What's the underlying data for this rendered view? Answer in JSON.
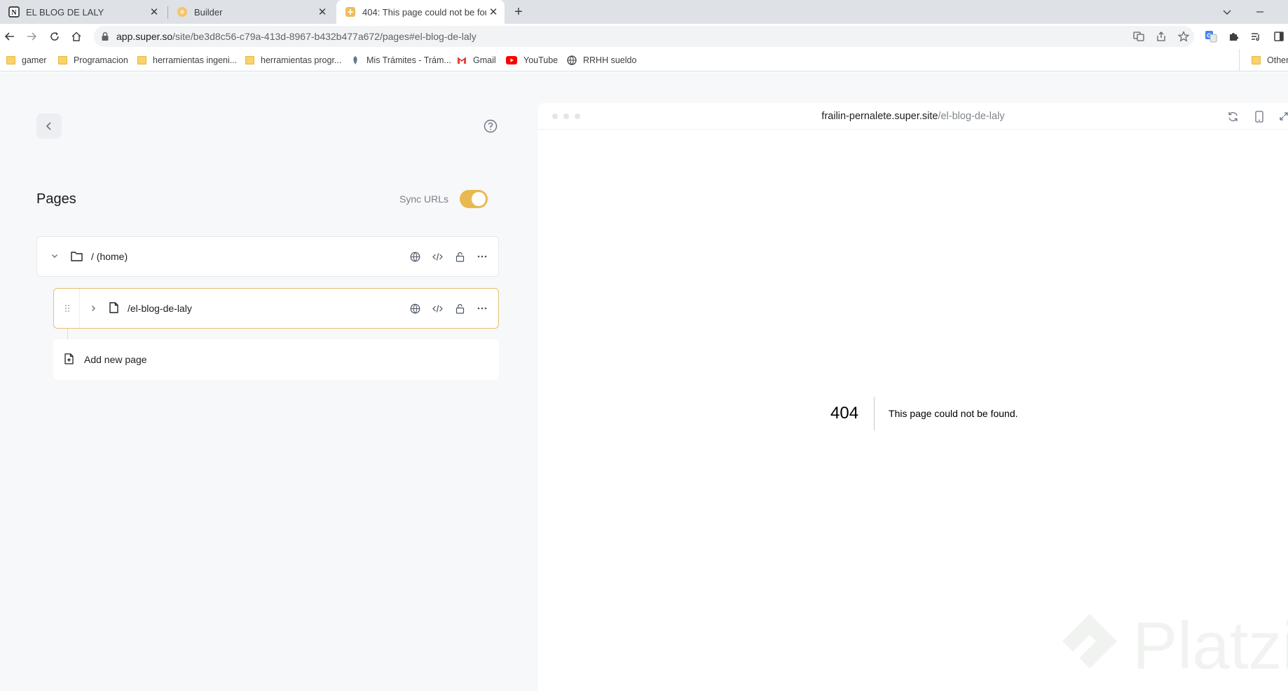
{
  "browser": {
    "tabs": [
      {
        "title": "EL BLOG DE LALY",
        "icon": "notion-icon",
        "active": false
      },
      {
        "title": "Builder",
        "icon": "super-icon",
        "active": false
      },
      {
        "title": "404: This page could not be foun",
        "icon": "super-icon",
        "active": true
      }
    ],
    "close_glyph": "✕",
    "new_tab_glyph": "+",
    "url": {
      "host": "app.super.so",
      "path": "/site/be3d8c56-c79a-413d-8967-b432b477a672/pages#el-blog-de-laly"
    },
    "bookmarks": [
      {
        "label": "gamer",
        "icon": "folder-icon"
      },
      {
        "label": "Programacion",
        "icon": "folder-icon"
      },
      {
        "label": "herramientas ingeni...",
        "icon": "folder-icon"
      },
      {
        "label": "herramientas progr...",
        "icon": "folder-icon"
      },
      {
        "label": "Mis Trámites - Trám...",
        "icon": "argentina-icon"
      },
      {
        "label": "Gmail",
        "icon": "gmail-icon"
      },
      {
        "label": "YouTube",
        "icon": "youtube-icon"
      },
      {
        "label": "RRHH sueldo",
        "icon": "globe-icon"
      }
    ],
    "other_bookmarks": "Other"
  },
  "colors": {
    "accent": "#e9b94f",
    "selected_border": "#e6bf70",
    "panel_bg": "#f7f8fa"
  },
  "pages_panel": {
    "title": "Pages",
    "sync_label": "Sync URLs",
    "sync_on": true,
    "rows": [
      {
        "label": "/ (home)",
        "icon": "folder-icon"
      },
      {
        "label": "/el-blog-de-laly",
        "icon": "page-icon",
        "selected": true
      }
    ],
    "add_page_label": "Add new page"
  },
  "preview": {
    "domain": "frailin-pernalete.super.site",
    "path": "/el-blog-de-laly",
    "error_code": "404",
    "error_message": "This page could not be found."
  },
  "watermark": {
    "text": "Platzi"
  }
}
